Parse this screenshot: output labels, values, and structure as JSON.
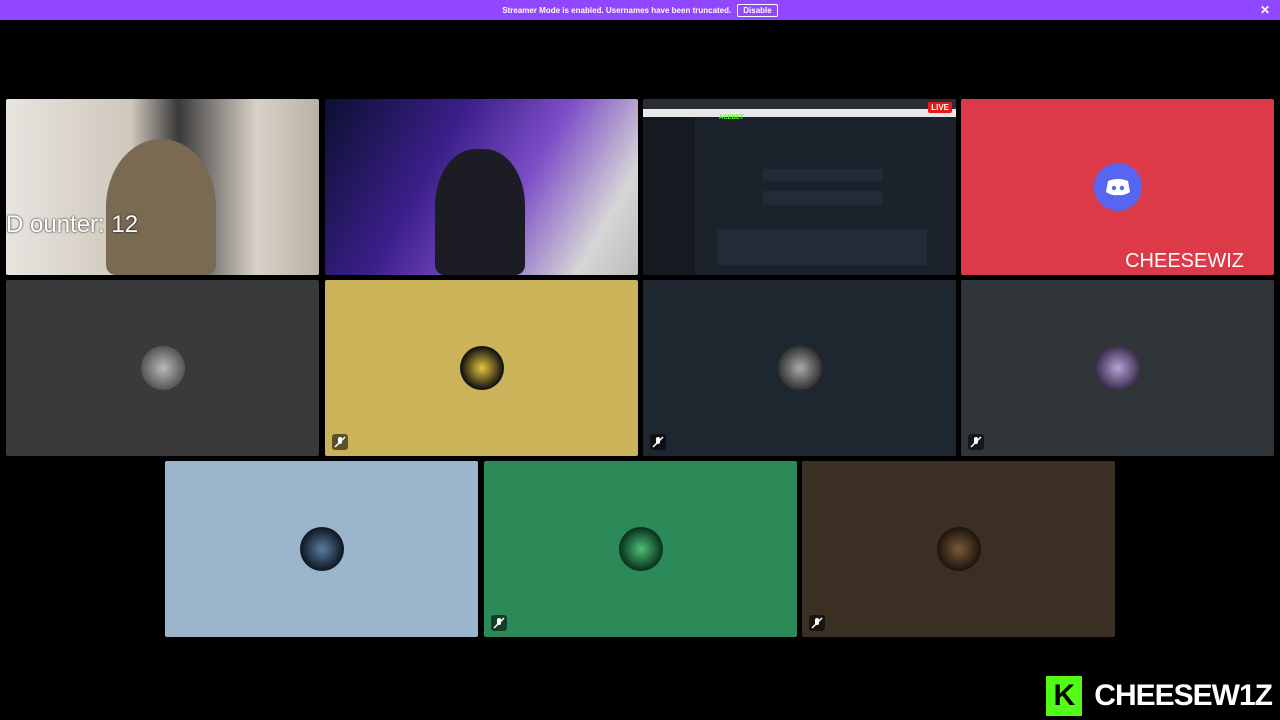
{
  "banner": {
    "text": "Streamer Mode is enabled. Usernames have been truncated.",
    "disable_label": "Disable",
    "close_glyph": "✕"
  },
  "tiles": [
    {
      "kind": "webcam",
      "overlay_text": "D    ounter: 12"
    },
    {
      "kind": "webcam"
    },
    {
      "kind": "screenshare",
      "live_label": "LIVE",
      "site_name": "ACEBET"
    },
    {
      "kind": "discord-avatar",
      "color": "#dc3a48",
      "name_label": "CHEESEWIZ"
    },
    {
      "kind": "avatar",
      "color": "#3a3a3a",
      "muted": false
    },
    {
      "kind": "avatar",
      "color": "#cbb35a",
      "muted": true
    },
    {
      "kind": "avatar",
      "color": "#1e2630",
      "muted": true
    },
    {
      "kind": "avatar",
      "color": "#30353a",
      "muted": true
    },
    {
      "kind": "avatar",
      "color": "#9bb6cc",
      "muted": false
    },
    {
      "kind": "avatar",
      "color": "#2b8a58",
      "muted": true
    },
    {
      "kind": "avatar",
      "color": "#3a2f22",
      "muted": true
    }
  ],
  "brand": {
    "logo_letter": "K",
    "name": "CHEESEW1Z",
    "accent": "#53fc18"
  }
}
